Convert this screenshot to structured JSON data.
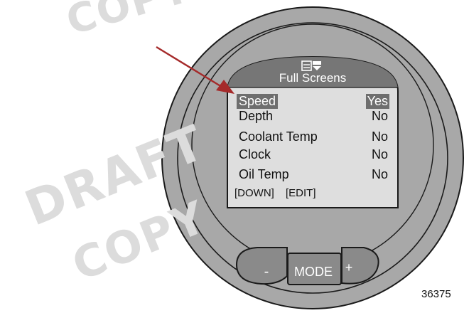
{
  "watermark": {
    "line1": "COPY",
    "line2": "DRAFT",
    "line3": "COPY"
  },
  "display": {
    "title": "Full Screens",
    "title_icon": "screen-select-icon",
    "rows": [
      {
        "label": "Speed",
        "value": "Yes",
        "selected": true
      },
      {
        "label": "Depth",
        "value": "No",
        "selected": false
      },
      {
        "label": "Coolant Temp",
        "value": "No",
        "selected": false
      },
      {
        "label": "Clock",
        "value": "No",
        "selected": false
      },
      {
        "label": "Oil Temp",
        "value": "No",
        "selected": false
      }
    ],
    "softkeys": {
      "left": "[DOWN]",
      "right": "[EDIT]"
    }
  },
  "buttons": {
    "minus": "-",
    "mode": "MODE",
    "plus": "+"
  },
  "reference_number": "36375",
  "colors": {
    "bezel": "#a8a8a8",
    "screen": "#dedede",
    "title_band": "#767676",
    "button": "#8a8a8a",
    "highlight": "#6e6e6e",
    "arrow": "#a52a2a",
    "watermark": "#dcdcdc"
  }
}
